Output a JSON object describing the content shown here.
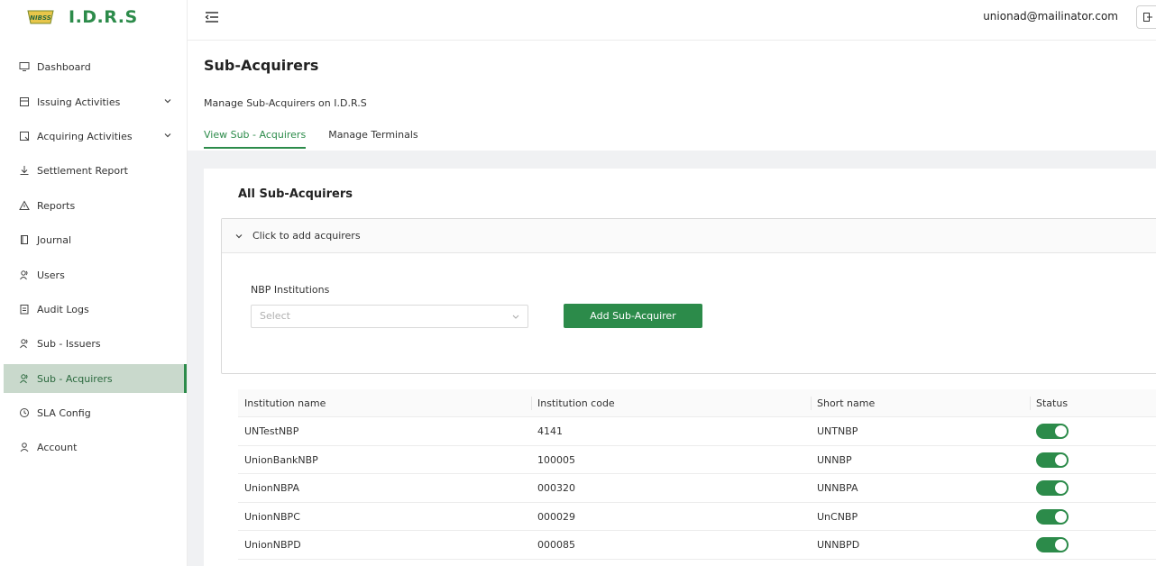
{
  "app": {
    "name": "I.D.R.S",
    "logo_text": "NIBSS"
  },
  "sidebar": {
    "items": [
      {
        "label": "Dashboard",
        "icon": "monitor-icon",
        "expandable": false
      },
      {
        "label": "Issuing Activities",
        "icon": "card-icon",
        "expandable": true
      },
      {
        "label": "Acquiring Activities",
        "icon": "terminal-icon",
        "expandable": true
      },
      {
        "label": "Settlement Report",
        "icon": "download-icon",
        "expandable": false
      },
      {
        "label": "Reports",
        "icon": "warning-icon",
        "expandable": false
      },
      {
        "label": "Journal",
        "icon": "book-icon",
        "expandable": false
      },
      {
        "label": "Users",
        "icon": "users-icon",
        "expandable": false
      },
      {
        "label": "Audit Logs",
        "icon": "clipboard-icon",
        "expandable": false
      },
      {
        "label": "Sub - Issuers",
        "icon": "users-icon",
        "expandable": false
      },
      {
        "label": "Sub - Acquirers",
        "icon": "users-icon",
        "expandable": false,
        "active": true
      },
      {
        "label": "SLA Config",
        "icon": "clock-icon",
        "expandable": false
      },
      {
        "label": "Account",
        "icon": "user-icon",
        "expandable": false
      }
    ]
  },
  "header": {
    "user_email": "unionad@mailinator.com"
  },
  "page": {
    "title": "Sub-Acquirers",
    "subtitle": "Manage Sub-Acquirers on I.D.R.S",
    "tabs": [
      {
        "label": "View Sub - Acquirers",
        "active": true
      },
      {
        "label": "Manage Terminals",
        "active": false
      }
    ]
  },
  "card": {
    "title": "All Sub-Acquirers",
    "collapse_label": "Click to add acquirers",
    "field_label": "NBP Institutions",
    "select_placeholder": "Select",
    "add_button": "Add Sub-Acquirer"
  },
  "table": {
    "columns": [
      "Institution name",
      "Institution code",
      "Short name",
      "Status"
    ],
    "rows": [
      {
        "name": "UNTestNBP",
        "code": "4141",
        "short": "UNTNBP",
        "status": true
      },
      {
        "name": "UnionBankNBP",
        "code": "100005",
        "short": "UNNBP",
        "status": true
      },
      {
        "name": "UnionNBPA",
        "code": "000320",
        "short": "UNNBPA",
        "status": true
      },
      {
        "name": "UnionNBPC",
        "code": "000029",
        "short": "UnCNBP",
        "status": true
      },
      {
        "name": "UnionNBPD",
        "code": "000085",
        "short": "UNNBPD",
        "status": true
      }
    ]
  },
  "colors": {
    "brand": "#2c8b4a",
    "active_bg": "#c9d9cc"
  }
}
